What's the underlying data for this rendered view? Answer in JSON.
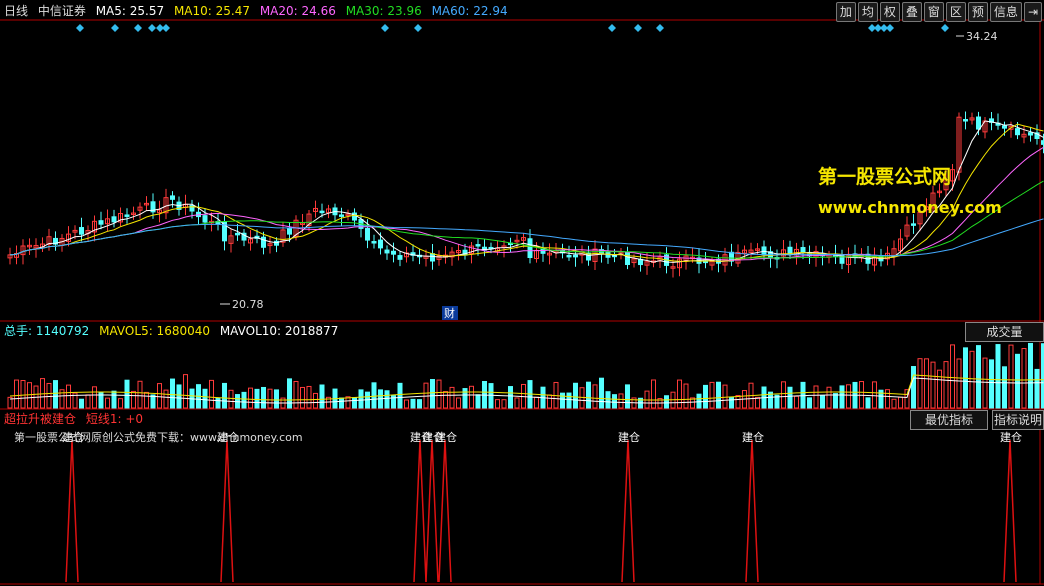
{
  "header": {
    "period": "日线",
    "stock": "中信证券",
    "ma5": "MA5: 25.57",
    "ma10": "MA10: 25.47",
    "ma20": "MA20: 24.66",
    "ma30": "MA30: 23.96",
    "ma60": "MA60: 22.94"
  },
  "toolbar": [
    "加",
    "均",
    "权",
    "叠",
    "窗",
    "区",
    "预",
    "信息",
    "⇥"
  ],
  "price_panel": {
    "high_label": "34.24",
    "low_label": "20.78",
    "event_badge": "财",
    "watermark_line1": "第一股票公式网",
    "watermark_line2": "www.chnmoney.com"
  },
  "volume_panel": {
    "total": "总手: 1140792",
    "mavol5": "MAVOL5: 1680040",
    "mavol10": "MAVOL10: 2018877",
    "button": "成交量"
  },
  "indicator_panel": {
    "name": "超拉升被建仓",
    "value": "短线1: +0",
    "note": "第一股票公式网原创公式免费下载：www.chnmoney.com",
    "signal_label": "建仓",
    "btn_best": "最优指标",
    "btn_help": "指标说明"
  },
  "colors": {
    "ma5": "#ffffff",
    "ma10": "#f5e600",
    "ma20": "#ff66ff",
    "ma30": "#22dd22",
    "ma60": "#44aaff",
    "up": "#ff3b3b",
    "down": "#55ffff",
    "signal": "#dd1111"
  }
}
